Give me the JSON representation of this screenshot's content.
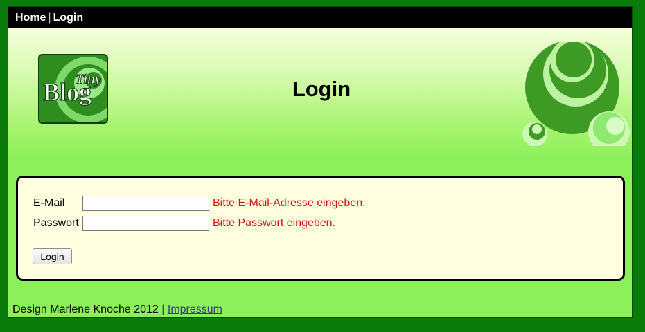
{
  "nav": {
    "home": "Home",
    "separator": "|",
    "login": "Login"
  },
  "logo": {
    "text_small": "Tiny",
    "text_large": "Blog"
  },
  "page_title": "Login",
  "form": {
    "email_label": "E-Mail",
    "email_value": "",
    "email_hint": "Bitte E-Mail-Adresse eingeben.",
    "password_label": "Passwort",
    "password_value": "",
    "password_hint": "Bitte Passwort eingeben.",
    "submit_label": "Login"
  },
  "footer": {
    "credit": "Design Marlene Knoche 2012",
    "separator": "|",
    "impressum": "Impressum"
  },
  "colors": {
    "outer_background": "#0a7a0a",
    "content_green": "#8cf05a",
    "panel_background": "#ffffe0",
    "hint_red": "#d81010",
    "nav_black": "#000000"
  }
}
